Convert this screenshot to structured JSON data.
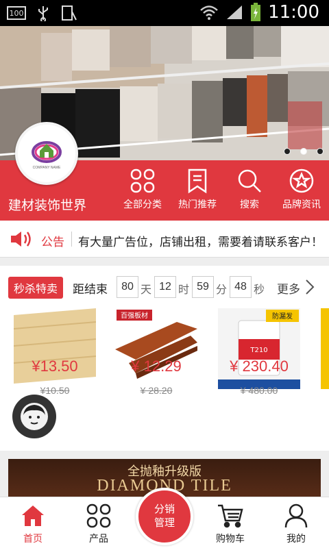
{
  "status_bar": {
    "battery_small": "100",
    "time": "11:00"
  },
  "header": {
    "store_name": "建材装饰世界",
    "logo_text": "COMPANY NAME",
    "nav": [
      {
        "label": "全部分类",
        "icon": "grid-icon"
      },
      {
        "label": "热门推荐",
        "icon": "bookmark-icon"
      },
      {
        "label": "搜索",
        "icon": "search-icon"
      },
      {
        "label": "品牌资讯",
        "icon": "badge-icon"
      }
    ]
  },
  "notice": {
    "label": "公告",
    "text": "有大量广告位，店铺出租，需要着请联系客户！"
  },
  "flash_sale": {
    "tag": "秒杀特卖",
    "ends_label": "距结束",
    "days": "80",
    "day_unit": "天",
    "hours": "12",
    "hour_unit": "时",
    "minutes": "59",
    "minute_unit": "分",
    "seconds": "48",
    "second_unit": "秒",
    "more": "更多",
    "products": [
      {
        "price": "¥13.50",
        "old_price": "¥10.50"
      },
      {
        "price": "¥ 12.29",
        "old_price": "¥ 28.20",
        "brand": "百强板材"
      },
      {
        "price": "¥ 230.40",
        "old_price": "¥ 480.00",
        "brand": "T210",
        "ribbon": "防漏发"
      }
    ]
  },
  "ad_banner": {
    "line1": "全抛釉升级版",
    "line2": "DIAMOND TILE"
  },
  "tabbar": {
    "tabs": [
      {
        "label": "首页",
        "icon": "home-icon"
      },
      {
        "label": "产品",
        "icon": "grid-icon"
      },
      {
        "label": "购物车",
        "icon": "cart-icon"
      },
      {
        "label": "我的",
        "icon": "user-icon"
      }
    ],
    "center_line1": "分销",
    "center_line2": "管理"
  },
  "colors": {
    "brand_red": "#e0383f"
  }
}
